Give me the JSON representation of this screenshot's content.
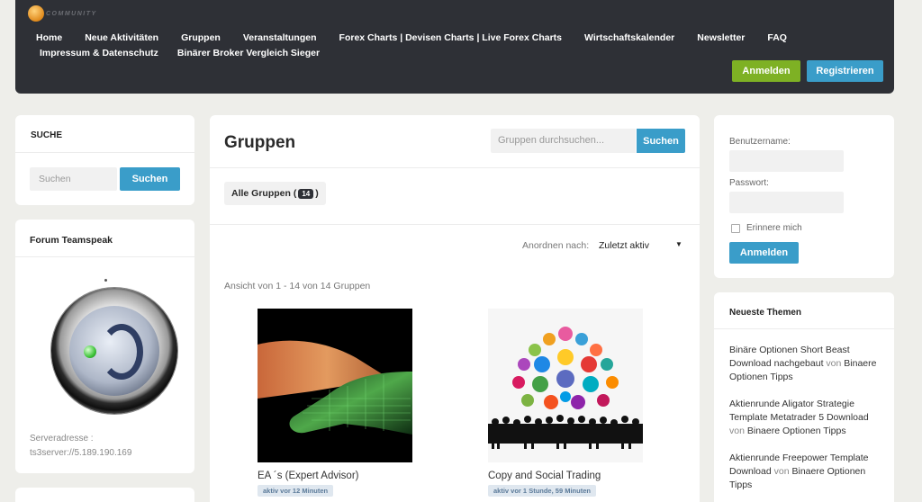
{
  "header": {
    "logo_text": "COMMUNITY",
    "nav_row1": [
      "Home",
      "Neue Aktivitäten",
      "Gruppen",
      "Veranstaltungen",
      "Forex Charts | Devisen Charts | Live Forex Charts",
      "Wirtschaftskalender",
      "Newsletter",
      "FAQ"
    ],
    "nav_row2": [
      "Impressum & Datenschutz",
      "Binärer Broker Vergleich Sieger"
    ],
    "login_label": "Anmelden",
    "register_label": "Registrieren",
    "colors": {
      "header_bg": "#2e3036",
      "green": "#7eb124",
      "blue": "#3a9dc9"
    }
  },
  "search_widget": {
    "title": "SUCHE",
    "placeholder": "Suchen",
    "button_label": "Suchen"
  },
  "teamspeak_widget": {
    "title": "Forum Teamspeak",
    "address_label": "Serveradresse :",
    "address_value": "ts3server://5.189.190.169"
  },
  "main": {
    "title": "Gruppen",
    "search_placeholder": "Gruppen durchsuchen...",
    "search_button": "Suchen",
    "tab_all_label": "Alle Gruppen (",
    "tab_all_count": "14",
    "tab_all_close": ")",
    "sort_label": "Anordnen nach:",
    "sort_value": "Zuletzt aktiv",
    "count_text": "Ansicht von 1 - 14 von 14 Gruppen",
    "groups": [
      {
        "name": "EA ´s (Expert Advisor)",
        "activity": "aktiv vor 12 Minuten"
      },
      {
        "name": "Copy and Social Trading",
        "activity": "aktiv vor 1 Stunde, 59 Minuten"
      }
    ]
  },
  "login_widget": {
    "username_label": "Benutzername:",
    "password_label": "Passwort:",
    "remember_label": "Erinnere mich",
    "login_button": "Anmelden"
  },
  "themes_widget": {
    "title": "Neueste Themen",
    "von": "von",
    "items": [
      {
        "title": "Binäre Optionen Short Beast Download nachgebaut",
        "author": "Binaere Optionen Tipps"
      },
      {
        "title": "Aktienrunde Aligator Strategie Template Metatrader 5 Download",
        "author": "Binaere Optionen Tipps"
      },
      {
        "title": "Aktienrunde Freepower Template Download",
        "author": "Binaere Optionen Tipps"
      }
    ]
  }
}
